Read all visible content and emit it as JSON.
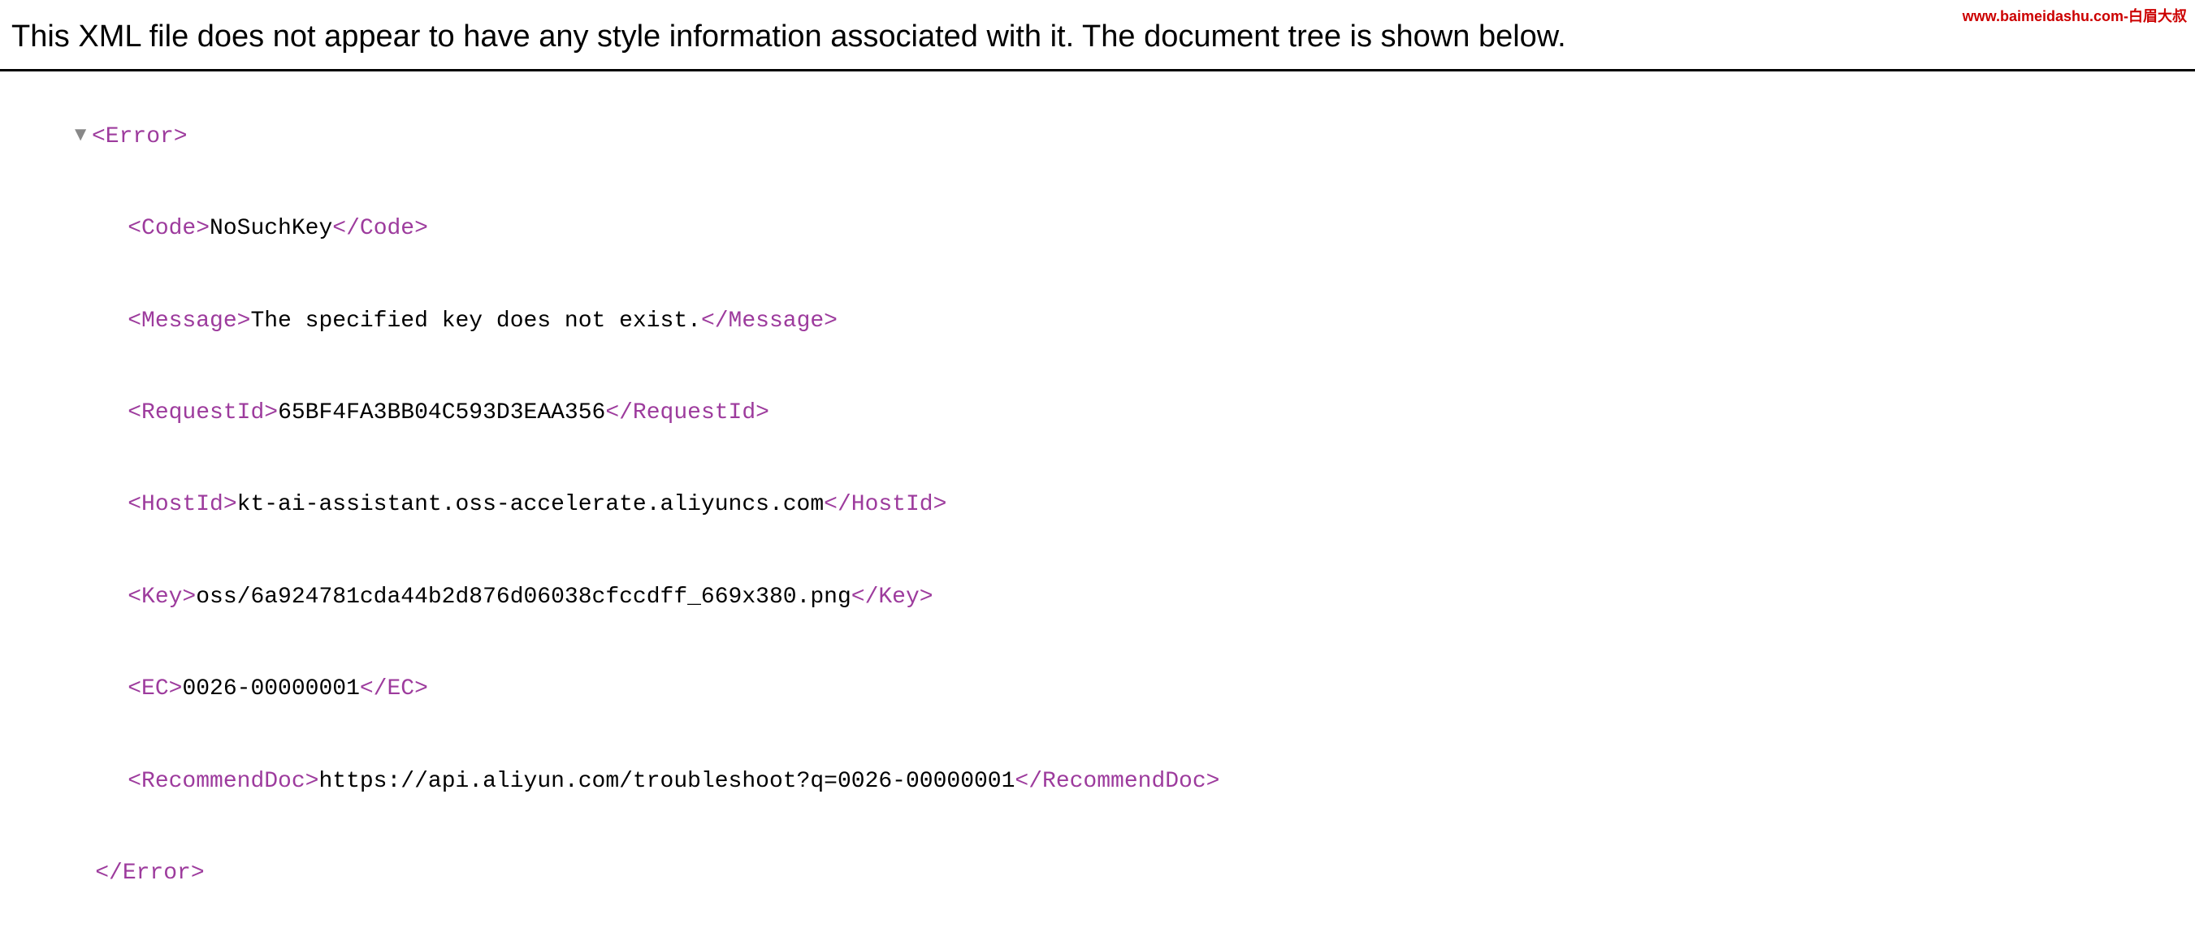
{
  "watermark": "www.baimeidashu.com-白眉大叔",
  "notice": "This XML file does not appear to have any style information associated with it. The document tree is shown below.",
  "xml": {
    "root_open": "<Error>",
    "root_close": "</Error>",
    "toggle": "▼",
    "children": [
      {
        "tag_open": "<Code>",
        "value": "NoSuchKey",
        "tag_close": "</Code>"
      },
      {
        "tag_open": "<Message>",
        "value": "The specified key does not exist.",
        "tag_close": "</Message>"
      },
      {
        "tag_open": "<RequestId>",
        "value": "65BF4FA3BB04C593D3EAA356",
        "tag_close": "</RequestId>"
      },
      {
        "tag_open": "<HostId>",
        "value": "kt-ai-assistant.oss-accelerate.aliyuncs.com",
        "tag_close": "</HostId>"
      },
      {
        "tag_open": "<Key>",
        "value": "oss/6a924781cda44b2d876d06038cfccdff_669x380.png",
        "tag_close": "</Key>"
      },
      {
        "tag_open": "<EC>",
        "value": "0026-00000001",
        "tag_close": "</EC>"
      },
      {
        "tag_open": "<RecommendDoc>",
        "value": "https://api.aliyun.com/troubleshoot?q=0026-00000001",
        "tag_close": "</RecommendDoc>"
      }
    ]
  }
}
